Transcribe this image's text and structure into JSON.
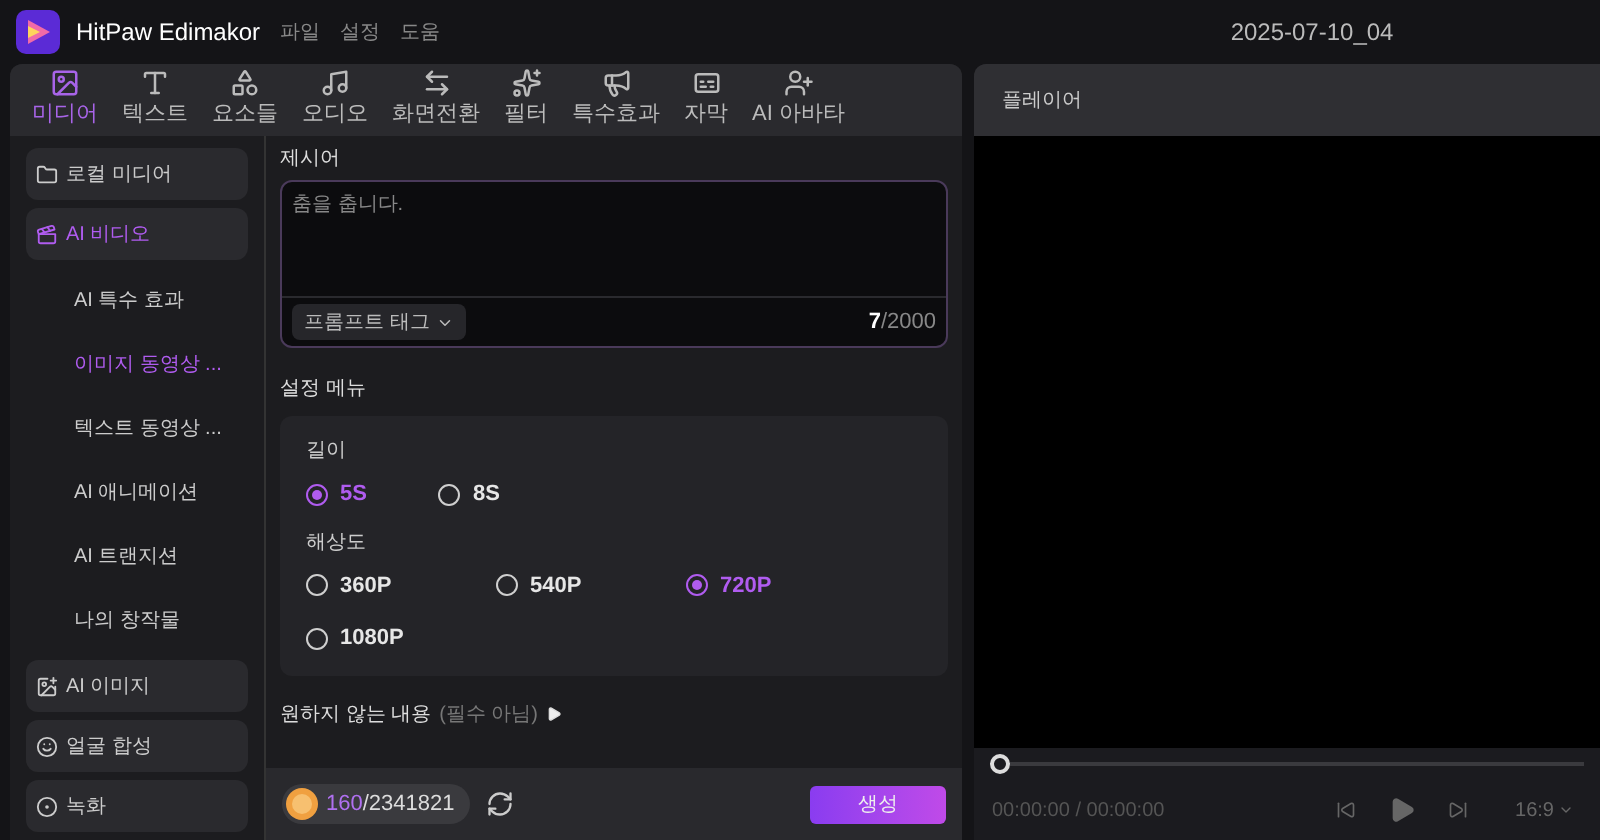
{
  "app": {
    "name": "HitPaw Edimakor",
    "menu": [
      "파일",
      "설정",
      "도움"
    ],
    "project_title": "2025-07-10_04"
  },
  "tabs": [
    {
      "label": "미디어",
      "selected": true
    },
    {
      "label": "텍스트",
      "selected": false
    },
    {
      "label": "요소들",
      "selected": false
    },
    {
      "label": "오디오",
      "selected": false
    },
    {
      "label": "화면전환",
      "selected": false
    },
    {
      "label": "필터",
      "selected": false
    },
    {
      "label": "특수효과",
      "selected": false
    },
    {
      "label": "자막",
      "selected": false
    },
    {
      "label": "AI 아바타",
      "selected": false
    }
  ],
  "sidebar": {
    "items": [
      {
        "label": "로컬 미디어",
        "selected": false
      },
      {
        "label": "AI 비디오",
        "selected": true,
        "expanded": true,
        "children": [
          {
            "label": "AI 특수 효과",
            "selected": false
          },
          {
            "label": "이미지 동영상 ...",
            "selected": true
          },
          {
            "label": "텍스트 동영상 ...",
            "selected": false
          },
          {
            "label": "AI 애니메이션",
            "selected": false
          },
          {
            "label": "AI 트랜지션",
            "selected": false
          },
          {
            "label": "나의 창작물",
            "selected": false
          }
        ]
      },
      {
        "label": "AI 이미지",
        "selected": false
      },
      {
        "label": "얼굴 합성",
        "selected": false
      },
      {
        "label": "녹화",
        "selected": false
      }
    ]
  },
  "prompt": {
    "label": "제시어",
    "value": "춤을 춥니다.",
    "tag_button": "프롬프트 태그",
    "count": "**7**/2000"
  },
  "settings": {
    "title": "설정 메뉴",
    "groups": [
      {
        "label": "길이",
        "options": [
          {
            "label": "5S",
            "selected": true
          },
          {
            "label": "8S",
            "selected": false
          }
        ]
      },
      {
        "label": "해상도",
        "options": [
          {
            "label": "360P",
            "selected": false
          },
          {
            "label": "540P",
            "selected": false
          },
          {
            "label": "720P",
            "selected": true
          },
          {
            "label": "1080P",
            "selected": false
          }
        ]
      }
    ]
  },
  "negative": {
    "label": "원하지 않는 내용",
    "hint": "(필수 아님)",
    "expanded": false
  },
  "footer": {
    "credits_used": "160",
    "credits_total": "/2341821",
    "generate_button": "생성"
  },
  "player": {
    "title": "플레이어",
    "progress": {
      "level": 0
    },
    "time": "00:00:00 / 00:00:00",
    "aspect": "16:9"
  }
}
